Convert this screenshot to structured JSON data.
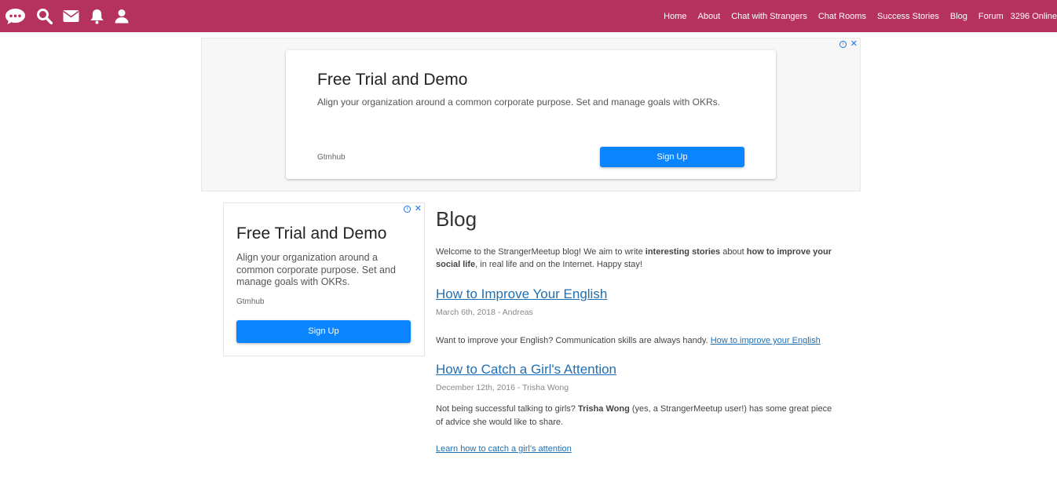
{
  "topbar": {
    "icons": [
      "chat-bubble-icon",
      "search-icon",
      "mail-icon",
      "bell-icon",
      "user-icon"
    ],
    "nav": [
      "Home",
      "About",
      "Chat with Strangers",
      "Chat Rooms",
      "Success Stories",
      "Blog",
      "Forum"
    ],
    "online": "3296 Online",
    "color": "#b5325e"
  },
  "ad_top": {
    "title": "Free Trial and Demo",
    "description": "Align your organization around a common corporate purpose. Set and manage goals with OKRs.",
    "brand": "Gtmhub",
    "cta": "Sign Up"
  },
  "ad_side": {
    "title": "Free Trial and Demo",
    "description": "Align your organization around a common corporate purpose. Set and manage goals with OKRs.",
    "brand": "Gtmhub",
    "cta": "Sign Up"
  },
  "blog": {
    "heading": "Blog",
    "intro_parts": {
      "a": "Welcome to the StrangerMeetup blog! We aim to write ",
      "b": "interesting stories",
      "c": " about ",
      "d": "how to improve your social life",
      "e": ", in real life and on the Internet. Happy stay!"
    },
    "posts": [
      {
        "title": "How to Improve Your English",
        "date": "March 6th, 2018",
        "sep": " - ",
        "author": "Andreas",
        "body": "Want to improve your English? Communication skills are always handy. ",
        "link": "How to improve your English"
      },
      {
        "title": "How to Catch a Girl's Attention",
        "date": "December 12th, 2016",
        "sep": " - ",
        "author": "Trisha Wong",
        "body_a": "Not being successful talking to girls? ",
        "body_b": "Trisha Wong",
        "body_c": " (yes, a StrangerMeetup user!) has some great piece of advice she would like to share.",
        "link": "Learn how to catch a girl's attention"
      }
    ]
  }
}
